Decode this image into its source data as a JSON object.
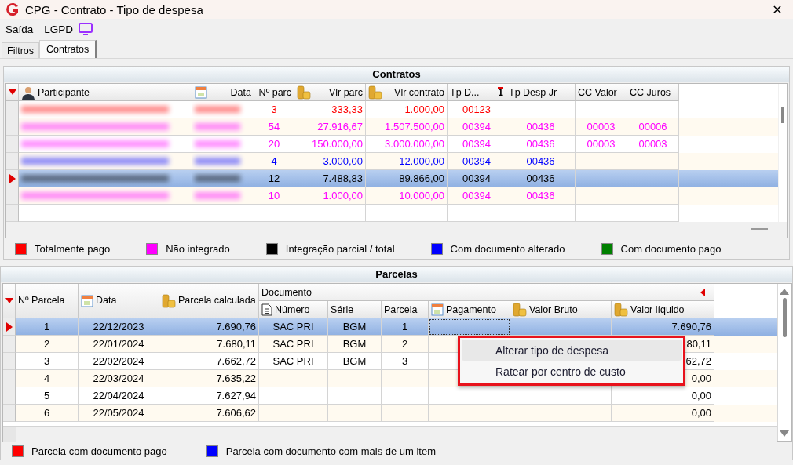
{
  "window": {
    "title": "CPG - Contrato - Tipo de despesa",
    "close": "✕"
  },
  "menu": [
    {
      "label": "Saída",
      "has_icon": false
    },
    {
      "label": "LGPD",
      "has_icon": true
    }
  ],
  "tabs": [
    {
      "label": "Filtros",
      "selected": false
    },
    {
      "label": "Contratos",
      "selected": true
    }
  ],
  "contratos": {
    "title": "Contratos",
    "columns": [
      {
        "label": "Participante"
      },
      {
        "label": "Data"
      },
      {
        "label": "Nº parc"
      },
      {
        "label": "Vlr parc"
      },
      {
        "label": "Vlr contrato"
      },
      {
        "label": "Tp D...",
        "sort_order": "1"
      },
      {
        "label": "Tp Desp Jr"
      },
      {
        "label": "CC Valor"
      },
      {
        "label": "CC Juros"
      }
    ],
    "rows": [
      {
        "selected": false,
        "blurred": true,
        "color": "#ff0000",
        "cells": [
          null,
          null,
          "3",
          "333,33",
          "1.000,00",
          "00123",
          null,
          null,
          null
        ]
      },
      {
        "selected": false,
        "blurred": true,
        "color": "#ff00ff",
        "cells": [
          null,
          null,
          "54",
          "27.916,67",
          "1.507.500,00",
          "00394",
          "00436",
          "00003",
          "00006"
        ]
      },
      {
        "selected": false,
        "blurred": true,
        "color": "#ff00ff",
        "cells": [
          null,
          null,
          "20",
          "150.000,00",
          "3.000.000,00",
          "00394",
          "00436",
          "00003",
          "00003"
        ]
      },
      {
        "selected": false,
        "blurred": true,
        "color": "#0000ff",
        "cells": [
          null,
          null,
          "4",
          "3.000,00",
          "12.000,00",
          "00394",
          "00436",
          null,
          null
        ]
      },
      {
        "selected": true,
        "blurred": true,
        "cells": [
          null,
          null,
          "12",
          "7.488,83",
          "89.866,00",
          "00394",
          "00436",
          null,
          null
        ]
      },
      {
        "selected": false,
        "blurred": true,
        "color": "#ff00ff",
        "cells": [
          null,
          null,
          "10",
          "1.000,00",
          "10.000,00",
          "00394",
          "00436",
          null,
          null
        ]
      },
      {
        "selected": false,
        "blurred": false,
        "cells": [
          null,
          null,
          null,
          null,
          null,
          null,
          null,
          null,
          null
        ]
      }
    ],
    "legend": [
      {
        "label": "Totalmente pago",
        "color": "#ff0000"
      },
      {
        "label": "Não integrado",
        "color": "#ff00ff"
      },
      {
        "label": "Integração parcial / total",
        "color": "#000000"
      },
      {
        "label": "Com documento alterado",
        "color": "#0000ff"
      },
      {
        "label": "Com documento pago",
        "color": "#008000"
      }
    ]
  },
  "parcelas": {
    "title": "Parcelas",
    "columns": [
      {
        "label": "Nº Parcela"
      },
      {
        "label": "Data"
      },
      {
        "label": "Parcela calculada"
      }
    ],
    "group": {
      "label": "Documento",
      "columns": [
        {
          "label": "Número"
        },
        {
          "label": "Série"
        },
        {
          "label": "Parcela"
        },
        {
          "label": "Pagamento"
        },
        {
          "label": "Valor Bruto"
        },
        {
          "label": "Valor líquido"
        }
      ]
    },
    "rows": [
      {
        "selected": true,
        "cells": [
          "1",
          "22/12/2023",
          "7.690,76",
          "SAC PRI",
          "BGM",
          "1",
          null,
          null,
          "7.690,76"
        ]
      },
      {
        "selected": false,
        "cells": [
          "2",
          "22/01/2024",
          "7.680,11",
          "SAC PRI",
          "BGM",
          "2",
          null,
          null,
          "80,11"
        ]
      },
      {
        "selected": false,
        "cells": [
          "3",
          "22/02/2024",
          "7.662,72",
          "SAC PRI",
          "BGM",
          "3",
          null,
          null,
          "62,72"
        ]
      },
      {
        "selected": false,
        "cells": [
          "4",
          "22/03/2024",
          "7.635,22",
          null,
          null,
          null,
          null,
          null,
          "0,00"
        ]
      },
      {
        "selected": false,
        "cells": [
          "5",
          "22/04/2024",
          "7.627,94",
          null,
          null,
          null,
          null,
          null,
          "0,00"
        ]
      },
      {
        "selected": false,
        "cells": [
          "6",
          "22/05/2024",
          "7.606,62",
          null,
          null,
          null,
          null,
          null,
          "0,00"
        ]
      }
    ],
    "context_menu": [
      {
        "label": "Alterar tipo de despesa",
        "selected": true
      },
      {
        "label": "Ratear por centro de custo",
        "selected": false
      }
    ],
    "legend": [
      {
        "label": "Parcela com documento pago",
        "color": "#ff0000"
      },
      {
        "label": "Parcela com documento com mais de um item",
        "color": "#0000ff"
      }
    ]
  }
}
